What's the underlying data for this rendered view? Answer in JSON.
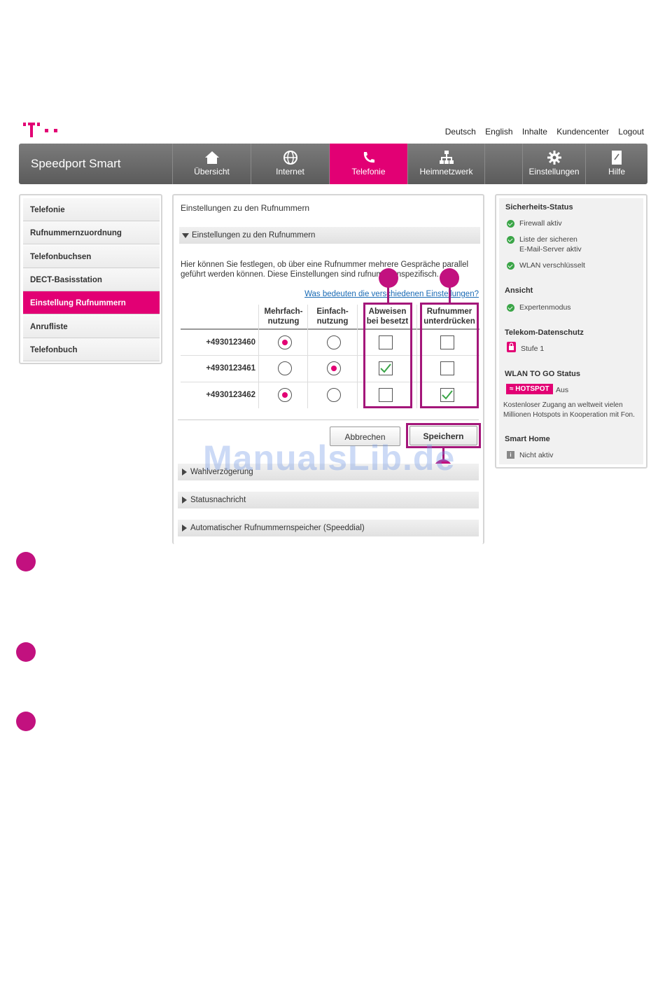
{
  "topnav": [
    "Deutsch",
    "English",
    "Inhalte",
    "Kundencenter",
    "Logout"
  ],
  "brand": "Speedport Smart",
  "nav": [
    {
      "label": "Übersicht",
      "icon": "home-icon"
    },
    {
      "label": "Internet",
      "icon": "globe-icon"
    },
    {
      "label": "Telefonie",
      "icon": "phone-icon"
    },
    {
      "label": "Heimnetzwerk",
      "icon": "network-icon"
    },
    {
      "label": "",
      "icon": ""
    },
    {
      "label": "Einstellungen",
      "icon": "gear-icon"
    },
    {
      "label": "Hilfe",
      "icon": "help-book-icon"
    }
  ],
  "sidebar": [
    "Telefonie",
    "Rufnummernzuordnung",
    "Telefonbuchsen",
    "DECT-Basisstation",
    "Einstellung Rufnummern",
    "Anrufliste",
    "Telefonbuch"
  ],
  "content": {
    "title": "Einstellungen zu den Rufnummern",
    "section_open": "Einstellungen zu den Rufnummern",
    "description_1": "Hier können Sie festlegen, ob über eine Rufnummer mehrere Gespräche parallel",
    "description_2": "geführt werden können. Diese Einstellungen sind rufnummernspezifisch.",
    "help_link": "Was bedeuten die verschiedenen Einstellungen?",
    "columns": [
      {
        "l1": "Mehrfach-",
        "l2": "nutzung"
      },
      {
        "l1": "Einfach-",
        "l2": "nutzung"
      },
      {
        "l1": "Abweisen",
        "l2": "bei besetzt"
      },
      {
        "l1": "Rufnummer",
        "l2": "unterdrücken"
      }
    ],
    "rows": [
      {
        "number": "+4930123460",
        "mehrfach": true,
        "einfach": false,
        "abweisen": false,
        "unterdruecken": false
      },
      {
        "number": "+4930123461",
        "mehrfach": false,
        "einfach": true,
        "abweisen": true,
        "unterdruecken": false
      },
      {
        "number": "+4930123462",
        "mehrfach": true,
        "einfach": false,
        "abweisen": false,
        "unterdruecken": true
      }
    ],
    "cancel": "Abbrechen",
    "save": "Speichern",
    "collapsed_sections": [
      "Wahlverzögerung",
      "Statusnachricht",
      "Automatischer Rufnummernspeicher (Speeddial)"
    ]
  },
  "status": {
    "security_title": "Sicherheits-Status",
    "firewall": "Firewall aktiv",
    "mail_1": "Liste der sicheren",
    "mail_2": "E-Mail-Server aktiv",
    "wlan": "WLAN verschlüsselt",
    "view_title": "Ansicht",
    "expert": "Expertenmodus",
    "privacy_title": "Telekom-Datenschutz",
    "privacy_level": "Stufe 1",
    "wlan_togo_title": "WLAN TO GO Status",
    "hotspot_badge": "HOTSPOT",
    "hotspot_state": "Aus",
    "hotspot_desc_1": "Kostenloser Zugang an weltweit vielen",
    "hotspot_desc_2": "Millionen Hotspots in Kooperation mit Fon.",
    "smarthome_title": "Smart Home",
    "smarthome_state": "Nicht aktiv"
  },
  "watermark": "ManualsLib.de",
  "colors": {
    "magenta": "#e20074",
    "callout": "#c2117f",
    "nav_gray": "#6b6b6b",
    "ok_green": "#3aa547",
    "link_blue": "#1a6bb5"
  }
}
